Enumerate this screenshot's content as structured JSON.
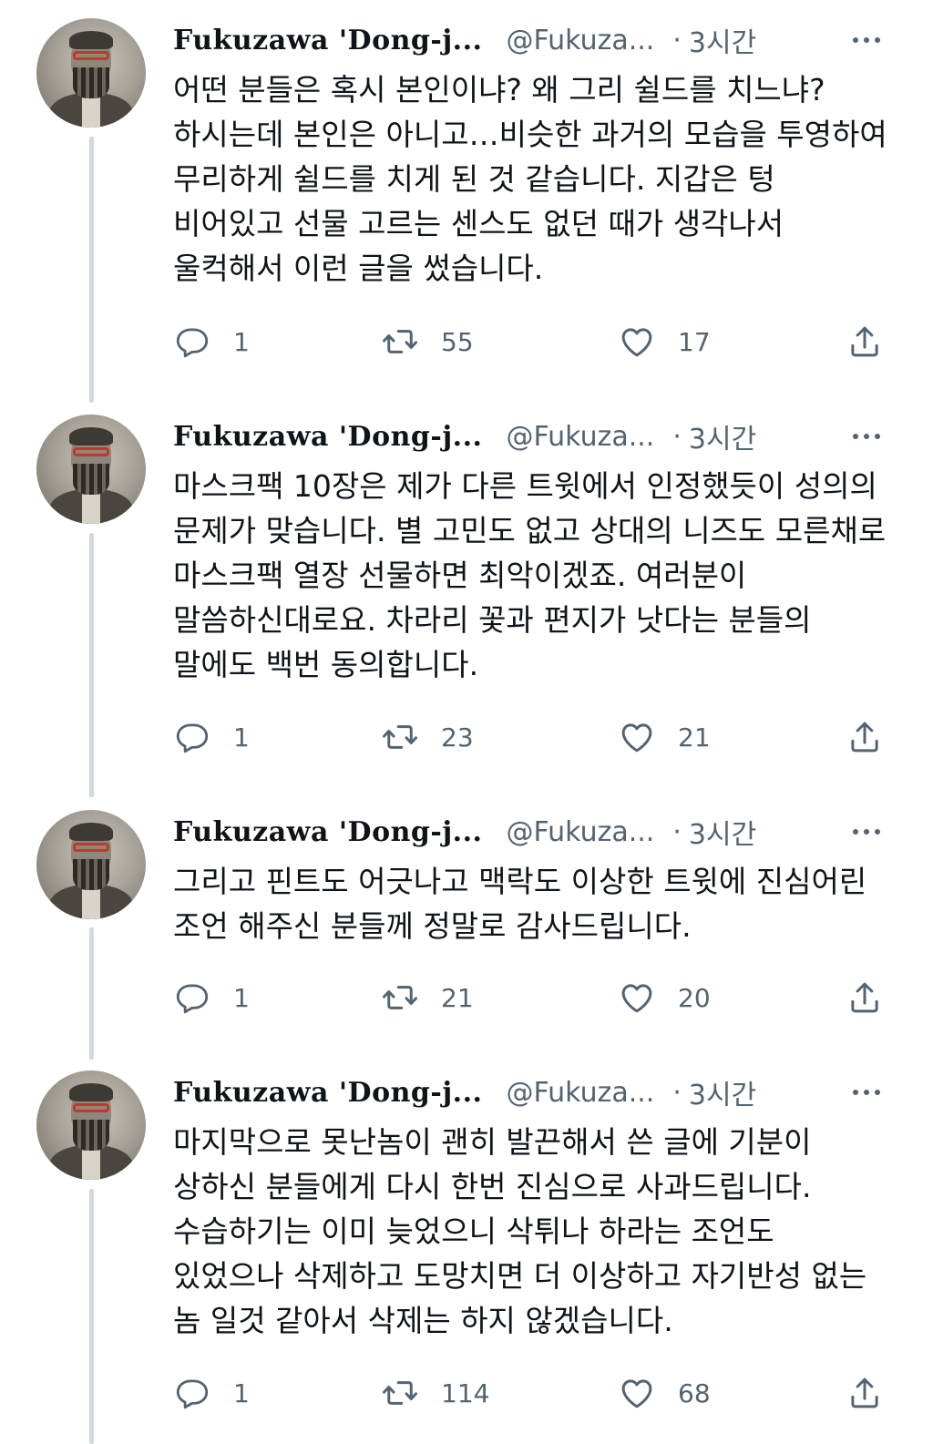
{
  "author": {
    "name": "Fukuzawa 'Dong-j...",
    "handle": "@Fukuza...",
    "separator": "·"
  },
  "colors": {
    "text": "#0f1419",
    "secondary": "#536471",
    "thread_line": "#cfd9de"
  },
  "tweets": [
    {
      "time": "3시간",
      "text": "어떤 분들은 혹시 본인이냐? 왜 그리 쉴드를 치느냐? 하시는데 본인은 아니고…비슷한 과거의 모습을 투영하여 무리하게 쉴드를 치게 된 것 같습니다. 지갑은 텅 비어있고 선물 고르는 센스도 없던 때가 생각나서 울컥해서 이런 글을 썼습니다.",
      "replies": "1",
      "retweets": "55",
      "likes": "17"
    },
    {
      "time": "3시간",
      "text": "마스크팩 10장은 제가 다른 트윗에서 인정했듯이 성의의 문제가 맞습니다. 별 고민도 없고 상대의 니즈도 모른채로 마스크팩 열장 선물하면 최악이겠죠. 여러분이 말씀하신대로요. 차라리 꽃과 편지가 낫다는 분들의 말에도 백번 동의합니다.",
      "replies": "1",
      "retweets": "23",
      "likes": "21"
    },
    {
      "time": "3시간",
      "text": "그리고 핀트도 어긋나고 맥락도 이상한 트윗에 진심어린 조언 해주신 분들께 정말로 감사드립니다.",
      "replies": "1",
      "retweets": "21",
      "likes": "20"
    },
    {
      "time": "3시간",
      "text": "마지막으로 못난놈이 괜히 발끈해서 쓴 글에 기분이 상하신 분들에게 다시 한번 진심으로 사과드립니다. 수습하기는 이미 늦었으니 삭튀나 하라는 조언도 있었으나 삭제하고 도망치면 더 이상하고 자기반성 없는 놈 일것 같아서 삭제는 하지 않겠습니다.",
      "replies": "1",
      "retweets": "114",
      "likes": "68"
    }
  ]
}
